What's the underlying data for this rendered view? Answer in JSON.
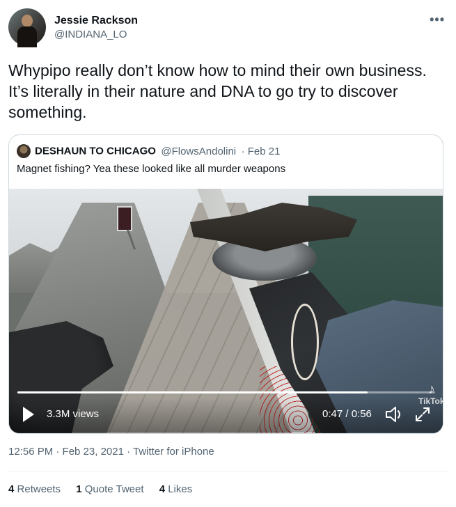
{
  "author": {
    "display_name": "Jessie Rackson",
    "handle": "@INDIANA_LO"
  },
  "menu_icon": "more-horizontal-icon",
  "tweet": {
    "text": "Whypipo really don’t know how to mind their own business. It’s literally in their nature and DNA to go try to discover something."
  },
  "quoted_tweet": {
    "display_name": "DESHAUN TO CHICAGO",
    "handle": "@FlowsAndolini",
    "date": "· Feb 21",
    "text": "Magnet fishing? Yea these looked like all murder weapons",
    "video": {
      "views": "3.3M views",
      "time": "0:47 / 0:56",
      "progress": 0.839,
      "watermark": "TikTok"
    }
  },
  "timestamp": "12:56 PM · Feb 23, 2021 · Twitter for iPhone",
  "stats": {
    "retweets_count": "4",
    "retweets_label": "Retweets",
    "quotes_count": "1",
    "quotes_label": "Quote Tweet",
    "likes_count": "4",
    "likes_label": "Likes"
  },
  "colors": {
    "text_primary": "#0f1419",
    "text_secondary": "#536471",
    "border": "#cfd9de"
  }
}
